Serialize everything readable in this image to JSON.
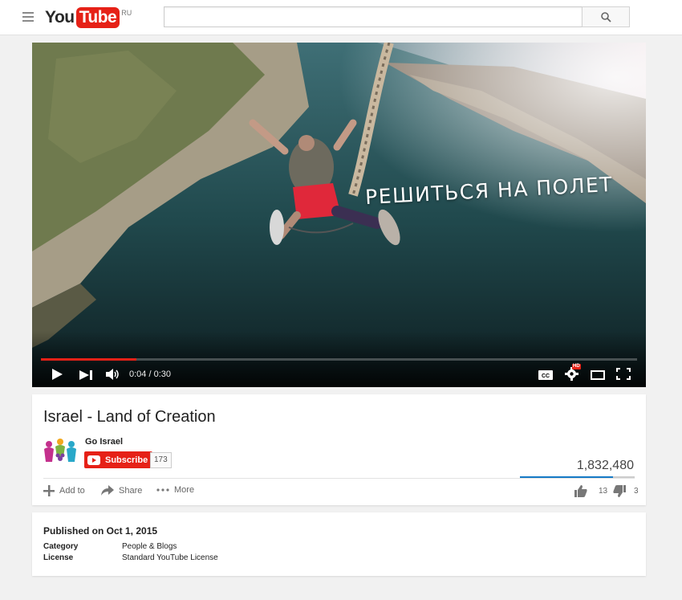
{
  "masthead": {
    "logo_you": "You",
    "logo_tube": "Tube",
    "region": "RU",
    "search": {
      "placeholder": "",
      "value": ""
    }
  },
  "player": {
    "overlay_text": "РЕШИТЬСЯ НА ПОЛЕТ",
    "time": "0:04 / 0:30",
    "progress_fraction": 0.16,
    "hd_badge": "HD",
    "cc_label": "CC"
  },
  "video": {
    "title": "Israel - Land of Creation",
    "channel": "Go Israel",
    "subscribe_label": "Subscribe",
    "subscriber_count": "173",
    "view_count": "1,832,480",
    "likes": "13",
    "dislikes": "3",
    "like_fraction": 0.81,
    "actions": {
      "add_to": "Add to",
      "share": "Share",
      "more": "More"
    }
  },
  "description": {
    "published": "Published on Oct 1, 2015",
    "category_label": "Category",
    "category_value": "People & Blogs",
    "license_label": "License",
    "license_value": "Standard YouTube License"
  },
  "colors": {
    "brand_red": "#e62117",
    "sentiment_blue": "#167ac6",
    "page_bg": "#f1f1f1"
  },
  "icons": [
    "menu-icon",
    "search-icon",
    "play-icon",
    "next-icon",
    "volume-icon",
    "captions-icon",
    "settings-icon",
    "theater-icon",
    "fullscreen-icon",
    "add-icon",
    "share-icon",
    "more-icon",
    "thumbs-up-icon",
    "thumbs-down-icon"
  ]
}
